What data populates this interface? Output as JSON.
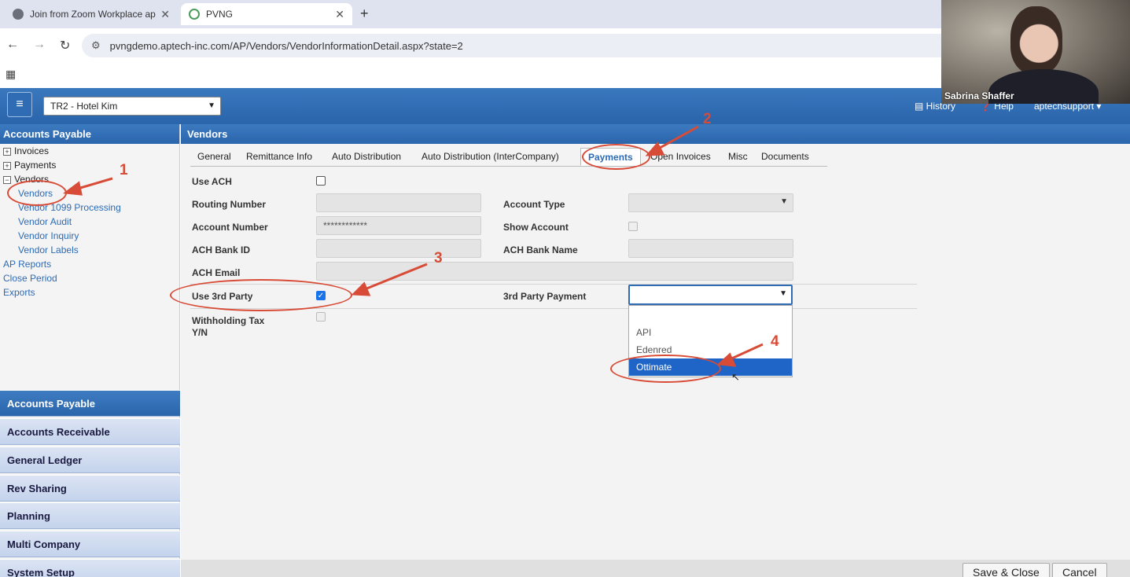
{
  "browser": {
    "tabs": [
      {
        "title": "Join from Zoom Workplace app",
        "active": false
      },
      {
        "title": "PVNG",
        "active": true
      }
    ],
    "url": "pvngdemo.aptech-inc.com/AP/Vendors/VendorInformationDetail.aspx?state=2"
  },
  "header": {
    "company": "TR2 - Hotel Kim",
    "links": [
      "History",
      "Help",
      "aptechsupport"
    ]
  },
  "sidebar": {
    "title": "Accounts Payable",
    "tree": {
      "invoices": "Invoices",
      "payments": "Payments",
      "vendors": "Vendors",
      "vendors_link": "Vendors",
      "vendor_1099": "Vendor 1099 Processing",
      "vendor_audit": "Vendor Audit",
      "vendor_inquiry": "Vendor Inquiry",
      "vendor_labels": "Vendor Labels",
      "ap_reports": "AP Reports",
      "close_period": "Close Period",
      "exports": "Exports"
    },
    "modules": [
      "Accounts Payable",
      "Accounts Receivable",
      "General Ledger",
      "Rev Sharing",
      "Planning",
      "Multi Company",
      "System Setup"
    ]
  },
  "main": {
    "title": "Vendors",
    "tabs": [
      "General",
      "Remittance Info",
      "Auto Distribution",
      "Auto Distribution (InterCompany)",
      "Payments",
      "Open Invoices",
      "Misc",
      "Documents"
    ],
    "form": {
      "use_ach": "Use ACH",
      "routing_number": "Routing Number",
      "account_type": "Account Type",
      "account_number": "Account Number",
      "account_number_value": "************",
      "show_account": "Show Account",
      "ach_bank_id": "ACH Bank ID",
      "ach_bank_name": "ACH Bank Name",
      "ach_email": "ACH Email",
      "use_3rd_party": "Use 3rd Party",
      "third_party_payment": "3rd Party Payment",
      "withholding_tax": "Withholding Tax",
      "withholding_tax_2": "Y/N"
    },
    "dropdown_options": [
      "API",
      "Edenred",
      "Ottimate"
    ],
    "dropdown_selected": "Ottimate"
  },
  "footer": {
    "save_close": "Save & Close",
    "cancel": "Cancel"
  },
  "annotations": [
    "1",
    "2",
    "3",
    "4"
  ],
  "video": {
    "participant": "Sabrina Shaffer"
  },
  "colors": {
    "accent": "#2b65ac",
    "annotation": "#d84b36",
    "selected": "#1f65c8"
  }
}
